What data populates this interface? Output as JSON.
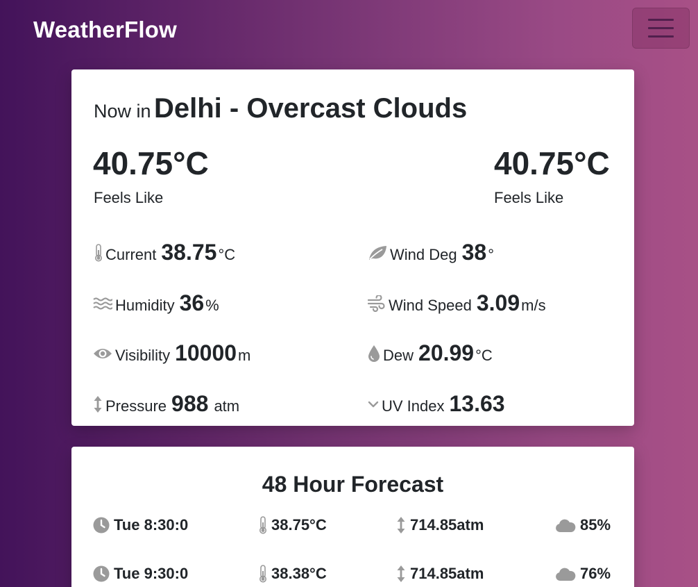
{
  "nav": {
    "brand": "WeatherFlow",
    "menu_icon": "hamburger-icon"
  },
  "now": {
    "prefix": "Now in",
    "city": "Delhi - Overcast Clouds",
    "temp_left": "40.75°C",
    "label_left": "Feels Like",
    "temp_right": "40.75°C",
    "label_right": "Feels Like",
    "stats": {
      "current": {
        "label": "Current",
        "value": "38.75",
        "unit": "°C",
        "icon": "thermometer-icon"
      },
      "humidity": {
        "label": "Humidity",
        "value": "36",
        "unit": "%",
        "icon": "water-waves-icon"
      },
      "visibility": {
        "label": "Visibility",
        "value": "10000",
        "unit": "m",
        "icon": "eye-icon"
      },
      "pressure": {
        "label": "Pressure",
        "value": "988",
        "unit": "atm",
        "icon": "arrows-vertical-icon"
      },
      "wind_deg": {
        "label": "Wind Deg",
        "value": "38",
        "unit": "°",
        "icon": "leaf-icon"
      },
      "wind_speed": {
        "label": "Wind Speed",
        "value": "3.09",
        "unit": "m/s",
        "icon": "wind-icon"
      },
      "dew": {
        "label": "Dew",
        "value": "20.99",
        "unit": "°C",
        "icon": "droplet-icon"
      },
      "uv": {
        "label": "UV Index",
        "value": "13.63",
        "unit": "",
        "icon": "chevron-down-icon"
      }
    }
  },
  "forecast": {
    "title": "48 Hour Forecast",
    "rows": [
      {
        "time": "Tue 8:30:0",
        "temp": "38.75°C",
        "pressure": "714.85atm",
        "clouds": "85%"
      },
      {
        "time": "Tue 9:30:0",
        "temp": "38.38°C",
        "pressure": "714.85atm",
        "clouds": "76%"
      }
    ]
  },
  "colors": {
    "accent_dark": "#43135a",
    "accent_light": "#a85086",
    "icon_gray": "#9a9a9a"
  }
}
